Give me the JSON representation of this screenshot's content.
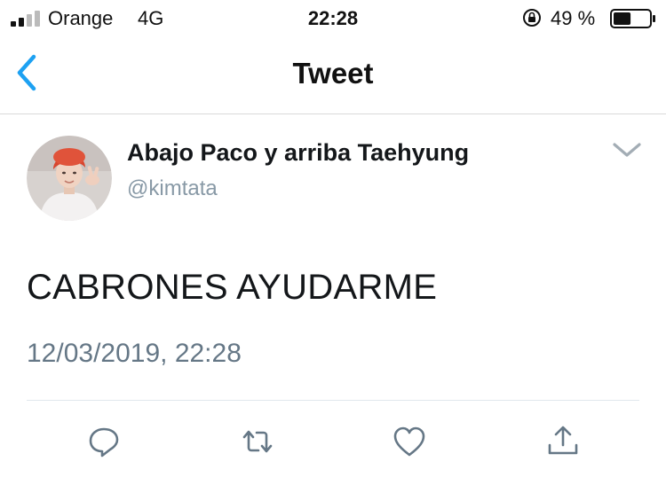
{
  "status_bar": {
    "carrier": "Orange",
    "network": "4G",
    "time": "22:28",
    "battery_percent": "49 %",
    "battery_level": 0.49
  },
  "nav": {
    "title": "Tweet"
  },
  "tweet": {
    "display_name": "Abajo Paco y arriba Taehyung",
    "username": "@kimtata",
    "text": "CABRONES AYUDARME",
    "timestamp": "12/03/2019, 22:28"
  },
  "colors": {
    "accent": "#1da1f2",
    "action_icons": "#657786"
  },
  "icons": {
    "back": "chevron-left-icon",
    "more": "chevron-down-icon",
    "reply": "reply-icon",
    "retweet": "retweet-icon",
    "like": "heart-icon",
    "share": "share-icon"
  }
}
